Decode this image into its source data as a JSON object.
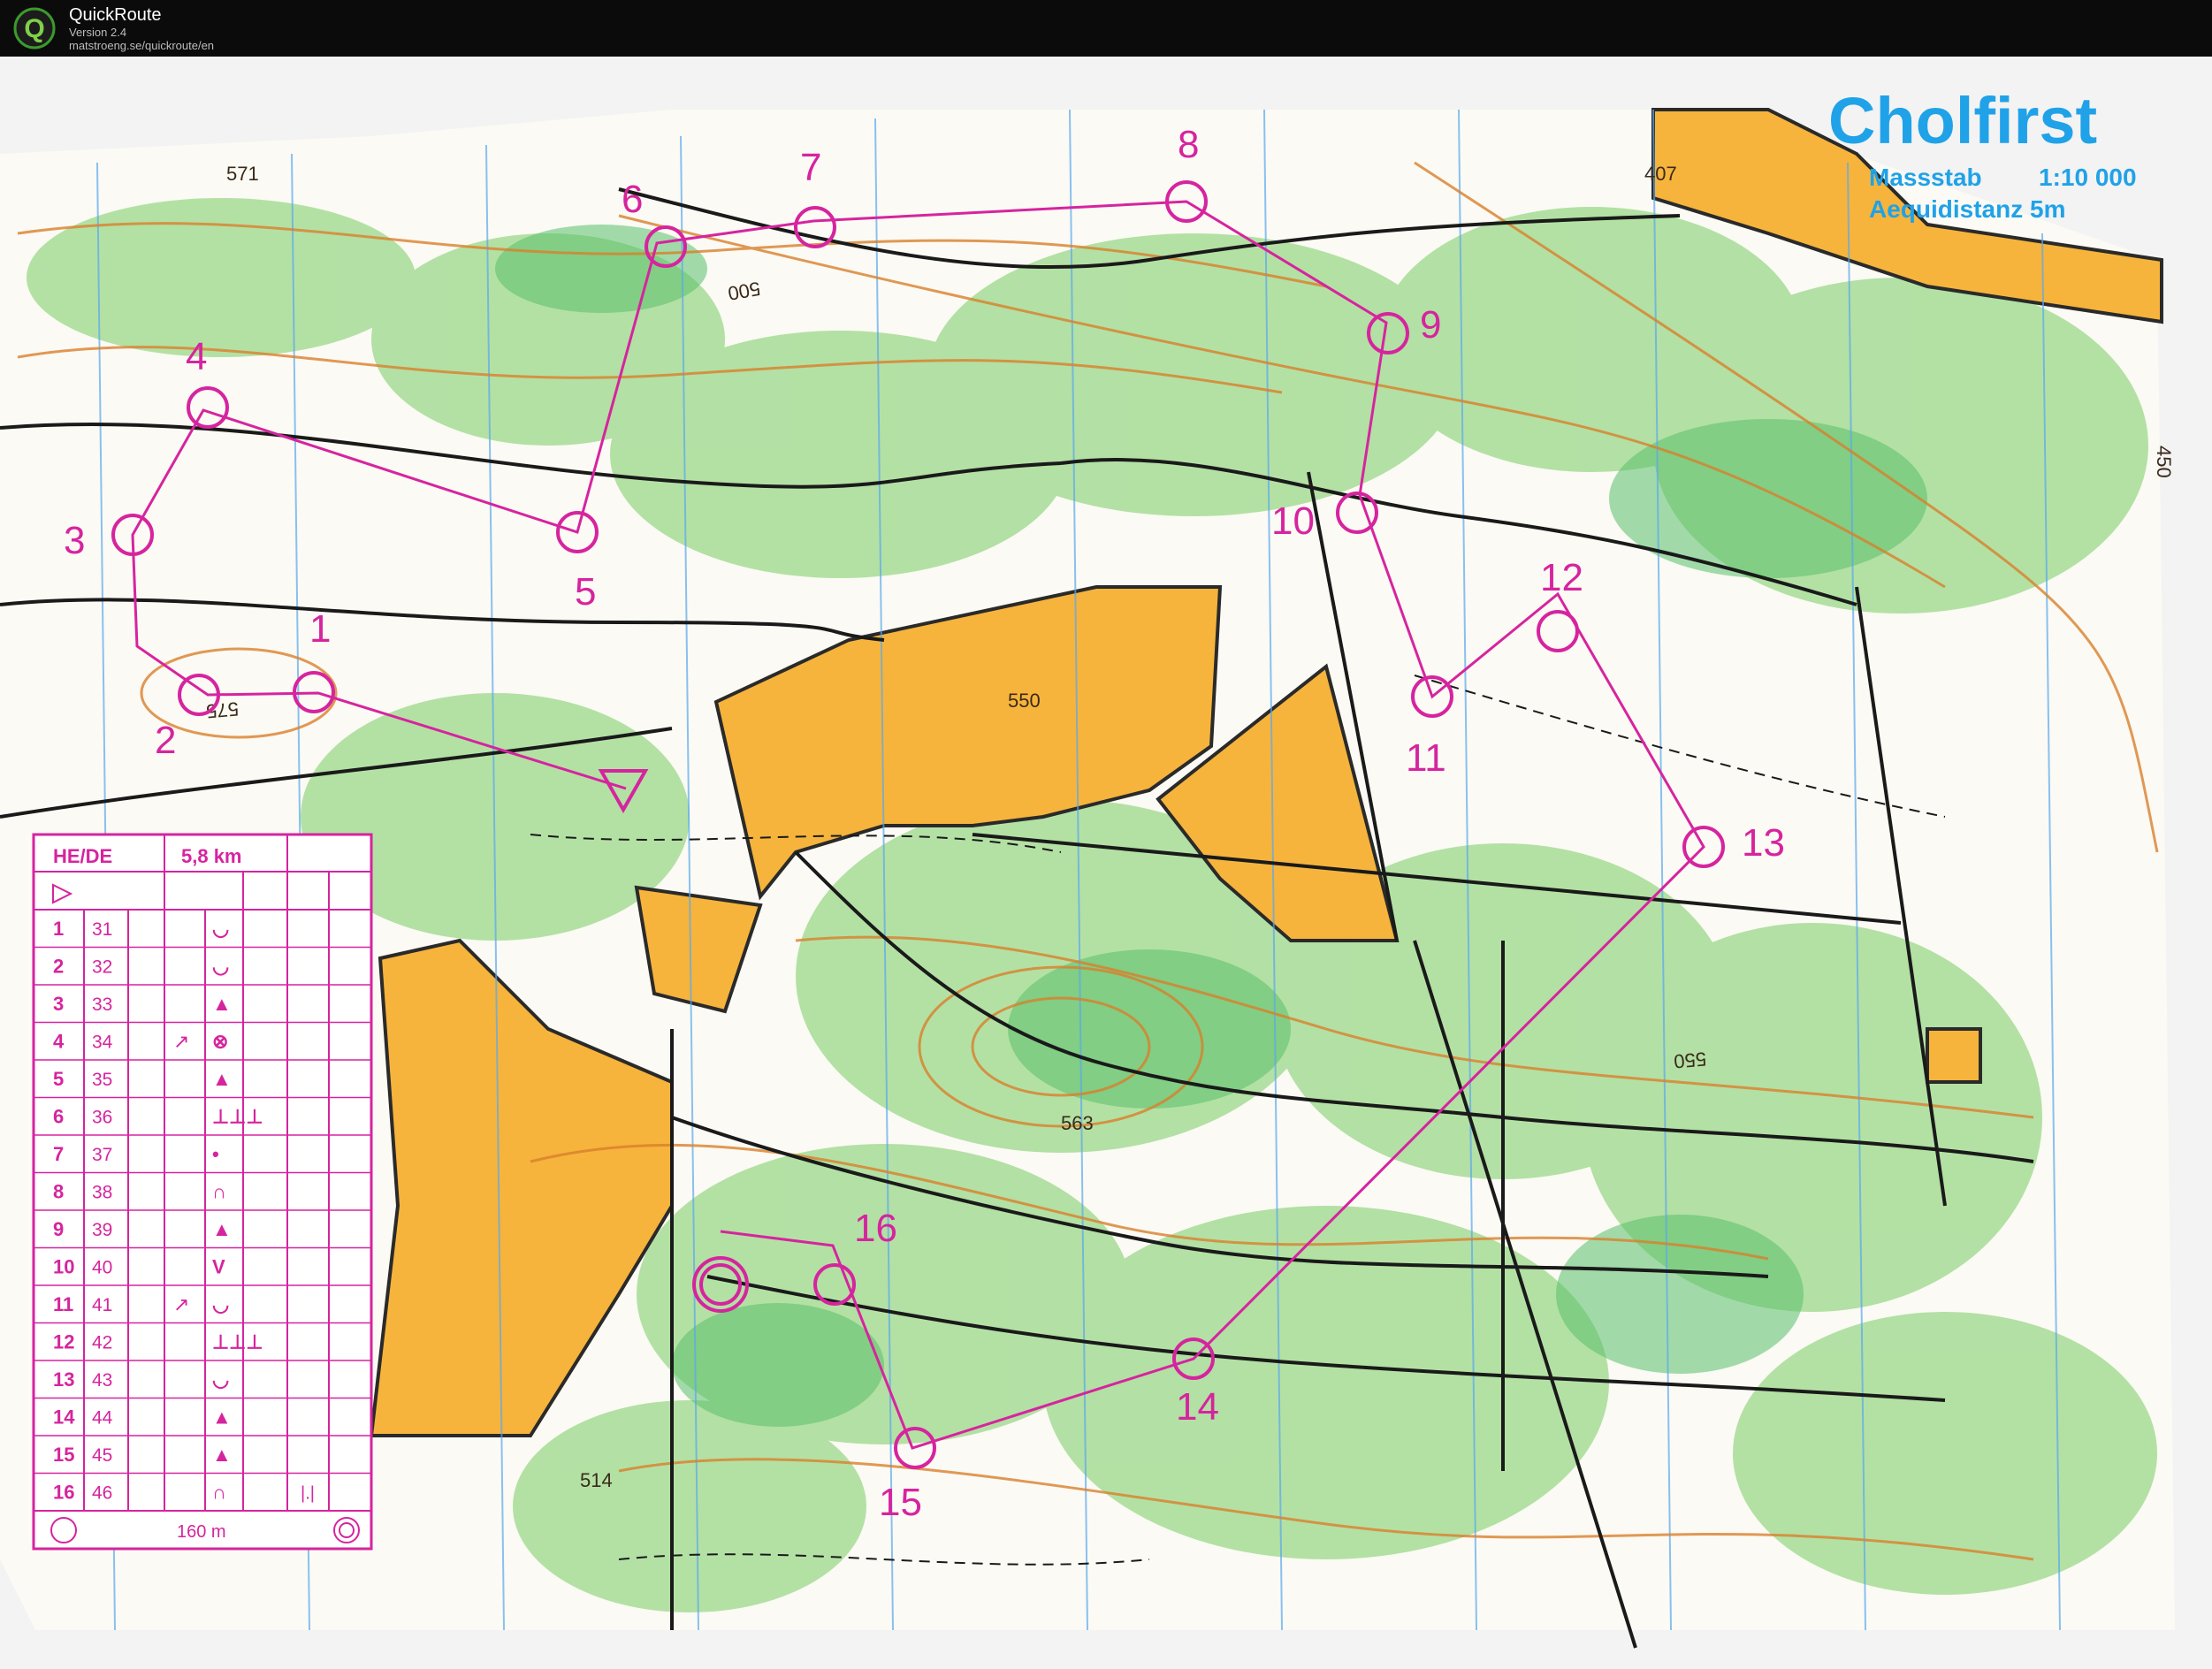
{
  "app": {
    "name": "QuickRoute",
    "version": "Version 2.4",
    "url": "matstroeng.se/quickroute/en",
    "logo_letter": "Q"
  },
  "map": {
    "title": "Cholfirst",
    "scale_label": "Massstab",
    "scale_value": "1:10 000",
    "contour": "Aequidistanz 5m",
    "heights": [
      "571",
      "407",
      "500",
      "550",
      "575",
      "563",
      "514",
      "550",
      "450"
    ],
    "colors": {
      "course": "#d6249f",
      "open": "#f6b43c",
      "forest": "#8fd37e",
      "title": "#20a2e8"
    }
  },
  "course": {
    "controls": [
      "1",
      "2",
      "3",
      "4",
      "5",
      "6",
      "7",
      "8",
      "9",
      "10",
      "11",
      "12",
      "13",
      "14",
      "15",
      "16"
    ]
  },
  "control_card": {
    "class": "HE/DE",
    "length": "5,8 km",
    "rows": [
      {
        "n": "1",
        "code": "31",
        "sym": "◡"
      },
      {
        "n": "2",
        "code": "32",
        "sym": "◡"
      },
      {
        "n": "3",
        "code": "33",
        "sym": "▲"
      },
      {
        "n": "4",
        "code": "34",
        "dir": "↗",
        "sym": "⊗"
      },
      {
        "n": "5",
        "code": "35",
        "sym": "▲"
      },
      {
        "n": "6",
        "code": "36",
        "sym": "⊥⊥⊥"
      },
      {
        "n": "7",
        "code": "37",
        "sym": "•"
      },
      {
        "n": "8",
        "code": "38",
        "sym": "∩"
      },
      {
        "n": "9",
        "code": "39",
        "sym": "▲"
      },
      {
        "n": "10",
        "code": "40",
        "sym": "V"
      },
      {
        "n": "11",
        "code": "41",
        "dir": "↗",
        "sym": "◡"
      },
      {
        "n": "12",
        "code": "42",
        "sym": "⊥⊥⊥"
      },
      {
        "n": "13",
        "code": "43",
        "sym": "◡"
      },
      {
        "n": "14",
        "code": "44",
        "sym": "▲"
      },
      {
        "n": "15",
        "code": "45",
        "sym": "▲"
      },
      {
        "n": "16",
        "code": "46",
        "sym": "∩",
        "extra": "|.|"
      }
    ],
    "finish": "160 m"
  }
}
